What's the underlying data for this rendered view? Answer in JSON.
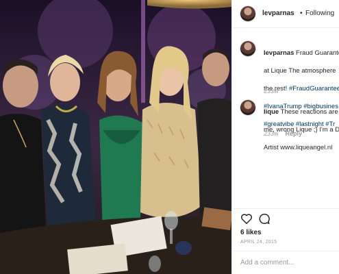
{
  "post": {
    "username": "levparnas",
    "separator": "•",
    "follow_status": "Following"
  },
  "caption": {
    "username": "levparnas",
    "line1": "Fraud Guarante",
    "line2": "at Lique The atmosphere",
    "line3": "the rest! ",
    "line3_tag": "#FraudGuaranteed",
    "line4": "#IvanaTrump #bigbusines",
    "line5": "#greatvibe #lastnight #Tr",
    "age": "233w"
  },
  "reply": {
    "username": "lique",
    "line1": "These reactions are",
    "line2": "me, wrong Lique ;) I'm a D",
    "line3": "Artist www.liqueangel.nl",
    "age": "233w",
    "reply_label": "Reply"
  },
  "icons": {
    "like": "heart-icon",
    "comment": "comment-bubble-icon"
  },
  "stats": {
    "likes": "6 likes",
    "date": "APRIL 24, 2015"
  },
  "add_comment": {
    "placeholder": "Add a comment..."
  },
  "colors": {
    "link": "#003569",
    "text": "#262626",
    "muted": "#999999",
    "border": "#efefef"
  }
}
